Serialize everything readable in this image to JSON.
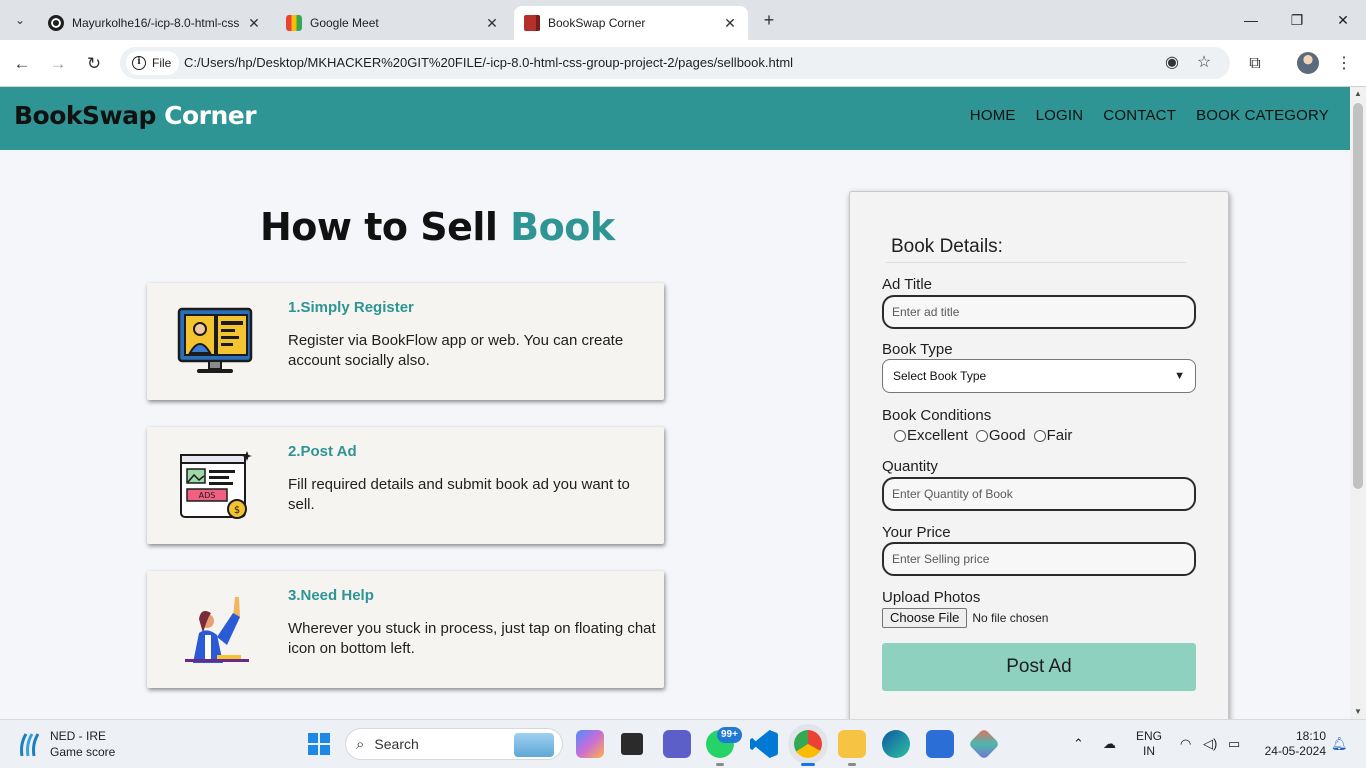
{
  "browser": {
    "tabs": [
      {
        "title": "Mayurkolhe16/-icp-8.0-html-css",
        "favicon": "github-icon",
        "active": false
      },
      {
        "title": "Google Meet",
        "favicon": "google-meet-icon",
        "active": false
      },
      {
        "title": "BookSwap Corner",
        "favicon": "book-icon",
        "active": true
      }
    ],
    "address": {
      "scheme_label": "File",
      "url": "C:/Users/hp/Desktop/MKHACKER%20GIT%20FILE/-icp-8.0-html-css-group-project-2/pages/sellbook.html"
    }
  },
  "site": {
    "brand_part1": "BookSwap",
    "brand_part2": "Corner",
    "nav": [
      "HOME",
      "LOGIN",
      "CONTACT",
      "BOOK CATEGORY"
    ],
    "colors": {
      "header": "#2e9494",
      "accent": "#2e9494",
      "post_button": "#8fd1bf"
    }
  },
  "howto": {
    "title_main": "How to Sell",
    "title_accent": "Book",
    "steps": [
      {
        "title": "1.Simply Register",
        "text": "Register via BookFlow app or web. You can create account socially also.",
        "icon": "register-monitor-icon"
      },
      {
        "title": "2.Post Ad",
        "text": "Fill required details and submit book ad you want to sell.",
        "icon": "post-ad-icon"
      },
      {
        "title": "3.Need Help",
        "text": "Wherever you stuck in process, just tap on floating chat icon on bottom left.",
        "icon": "need-help-icon"
      }
    ]
  },
  "form": {
    "heading": "Book Details:",
    "ad_title": {
      "label": "Ad Title",
      "placeholder": "Enter ad title"
    },
    "book_type": {
      "label": "Book Type",
      "selected": "Select Book Type"
    },
    "conditions": {
      "label": "Book Conditions",
      "options": [
        "Excellent",
        "Good",
        "Fair"
      ]
    },
    "quantity": {
      "label": "Quantity",
      "placeholder": "Enter Quantity of Book"
    },
    "price": {
      "label": "Your Price",
      "placeholder": "Enter Selling price"
    },
    "photos": {
      "label": "Upload Photos",
      "button": "Choose File",
      "status": "No file chosen"
    },
    "submit": "Post Ad"
  },
  "taskbar": {
    "weather_title": "NED - IRE",
    "weather_sub": "Game score",
    "search_placeholder": "Search",
    "whatsapp_badge": "99+",
    "language_line1": "ENG",
    "language_line2": "IN",
    "time": "18:10",
    "date": "24-05-2024"
  }
}
